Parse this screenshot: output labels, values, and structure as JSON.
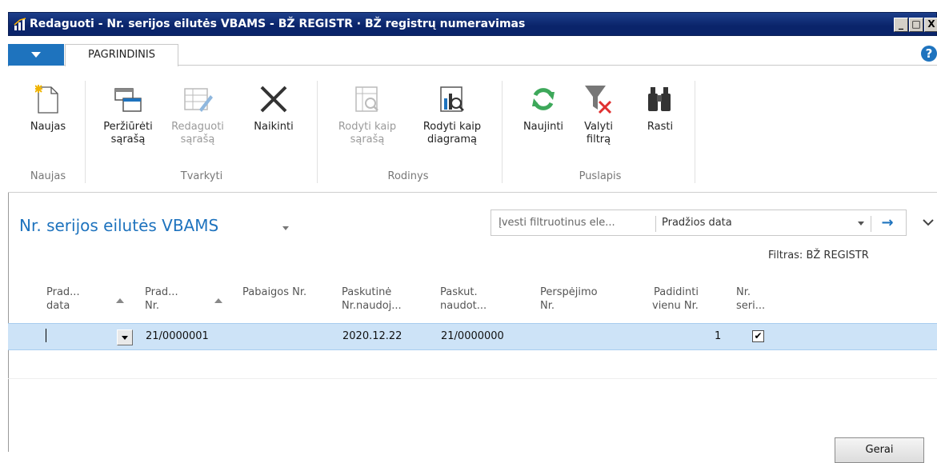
{
  "window": {
    "title": "Redaguoti - Nr. serijos eilutės VBAMS - BŽ REGISTR · BŽ registrų numeravimas",
    "minimize": "_",
    "maximize": "□",
    "close": "X"
  },
  "ribbon": {
    "tab_home": "PAGRINDINIS",
    "help": "?",
    "buttons": {
      "new": {
        "line1": "Naujas",
        "line2": ""
      },
      "view_list": {
        "line1": "Peržiūrėti",
        "line2": "sąrašą"
      },
      "edit_list": {
        "line1": "Redaguoti",
        "line2": "sąrašą"
      },
      "delete": {
        "line1": "Naikinti",
        "line2": ""
      },
      "show_as_list": {
        "line1": "Rodyti kaip",
        "line2": "sąrašą"
      },
      "show_as_chart": {
        "line1": "Rodyti kaip",
        "line2": "diagramą"
      },
      "refresh": {
        "line1": "Naujinti",
        "line2": ""
      },
      "clear_filter": {
        "line1": "Valyti",
        "line2": "filtrą"
      },
      "find": {
        "line1": "Rasti",
        "line2": ""
      }
    },
    "groups": {
      "new": "Naujas",
      "manage": "Tvarkyti",
      "view": "Rodinys",
      "page": "Puslapis"
    }
  },
  "page": {
    "title": "Nr. serijos eilutės VBAMS",
    "filter_placeholder": "Įvesti filtruotinus ele...",
    "filter_field": "Pradžios data",
    "filter_label": "Filtras: BŽ REGISTR"
  },
  "grid": {
    "headers": [
      {
        "l1": "Prad...",
        "l2": "data"
      },
      {
        "l1": "Prad...",
        "l2": "Nr."
      },
      {
        "l1": "Pabaigos Nr.",
        "l2": ""
      },
      {
        "l1": "Paskutinė",
        "l2": "Nr.naudoj..."
      },
      {
        "l1": "Paskut.",
        "l2": "naudot..."
      },
      {
        "l1": "Perspėjimo",
        "l2": "Nr."
      },
      {
        "l1": "Padidinti",
        "l2": "vienu Nr."
      },
      {
        "l1": "Nr.",
        "l2": "seri..."
      }
    ],
    "rows": [
      {
        "start_date": "",
        "start_no": "21/0000001",
        "end_no": "",
        "last_date_used": "2020.12.22",
        "last_no_used": "21/0000000",
        "warning_no": "",
        "increment": "1",
        "series_checked": "✔"
      }
    ]
  },
  "footer": {
    "ok": "Gerai"
  }
}
